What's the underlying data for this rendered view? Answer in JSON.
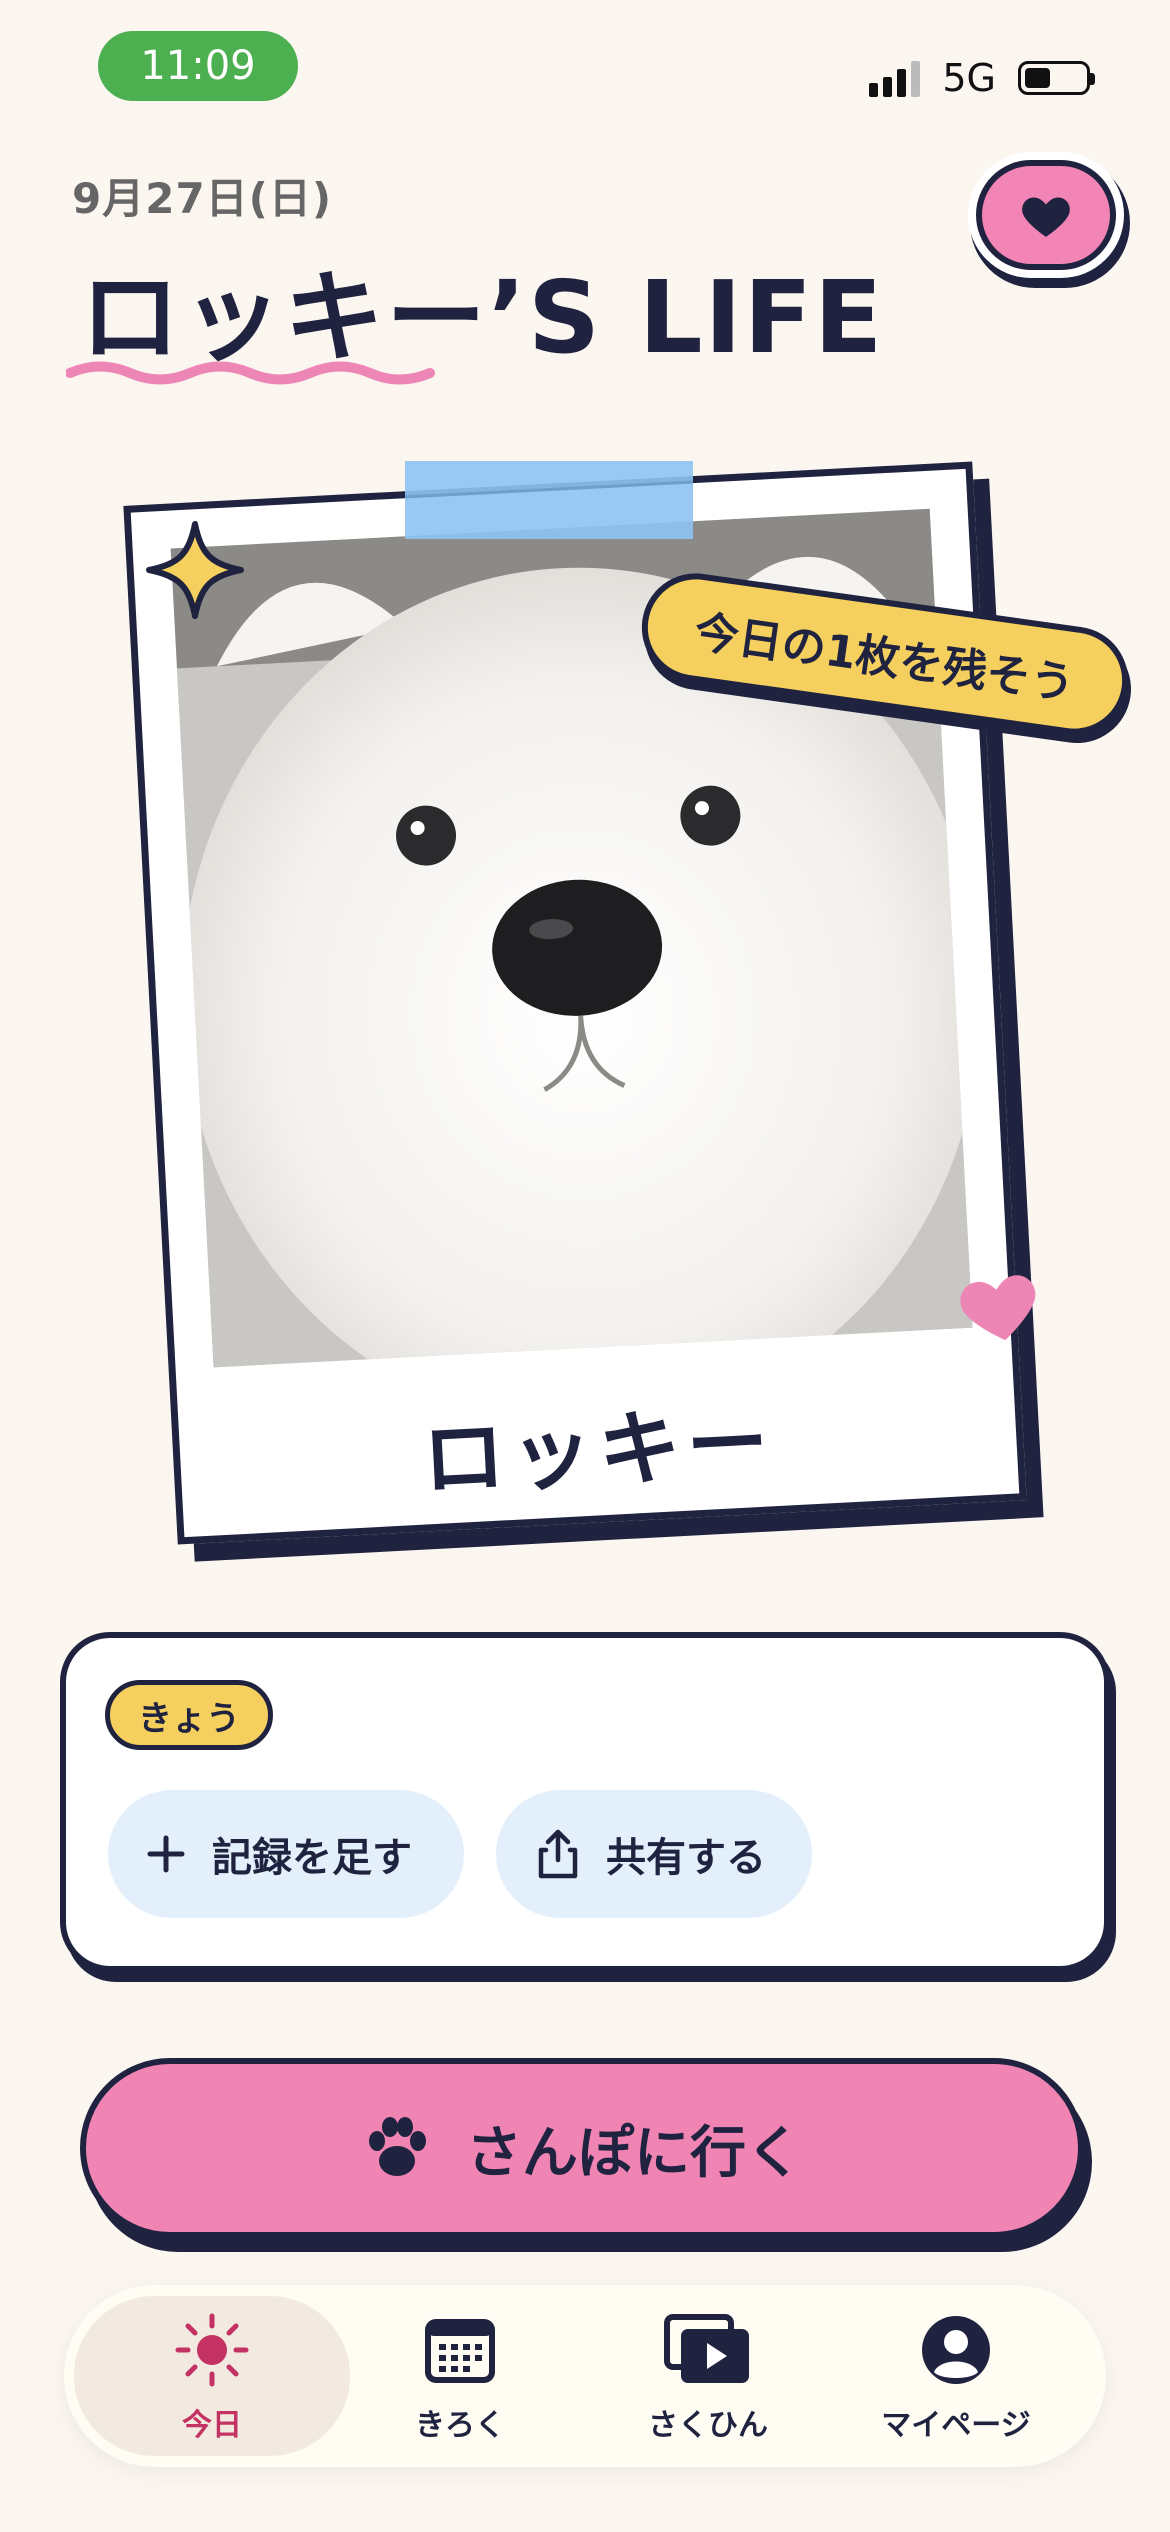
{
  "status_bar": {
    "time": "11:09",
    "network": "5G",
    "signal_bars": 4,
    "battery_level": 0.4
  },
  "header": {
    "date": "9月27日(日)",
    "title": "ロッキー’S LIFE",
    "favorite_icon": "heart-icon"
  },
  "photo_card": {
    "sticker_text": "今日の1枚を残そう",
    "pet_name": "ロッキー",
    "decorations": [
      "sparkle-icon",
      "heart-icon",
      "tape"
    ]
  },
  "today": {
    "badge": "きょう",
    "add_record_label": "記録を足す",
    "share_label": "共有する"
  },
  "walk_button": {
    "label": "さんぽに行く",
    "icon": "paw-icon"
  },
  "tabbar": {
    "tabs": [
      {
        "label": "今日",
        "icon": "sun-icon",
        "active": true
      },
      {
        "label": "きろく",
        "icon": "calendar-icon",
        "active": false
      },
      {
        "label": "さくひん",
        "icon": "video-library-icon",
        "active": false
      },
      {
        "label": "マイページ",
        "icon": "account-icon",
        "active": false
      }
    ]
  },
  "colors": {
    "background": "#FCF6F0",
    "navy": "#1F2340",
    "pink": "#F085B4",
    "yellow": "#F6D05E",
    "light_blue": "#E3F0FB",
    "green": "#4CAF50",
    "active_tab": "#C33263"
  }
}
